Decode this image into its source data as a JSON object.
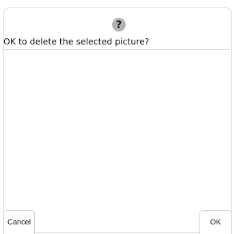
{
  "dialog": {
    "icon": "question-icon",
    "icon_glyph": "?",
    "message": "OK to delete the selected picture?",
    "cancel_label": "Cancel",
    "ok_label": "OK"
  }
}
